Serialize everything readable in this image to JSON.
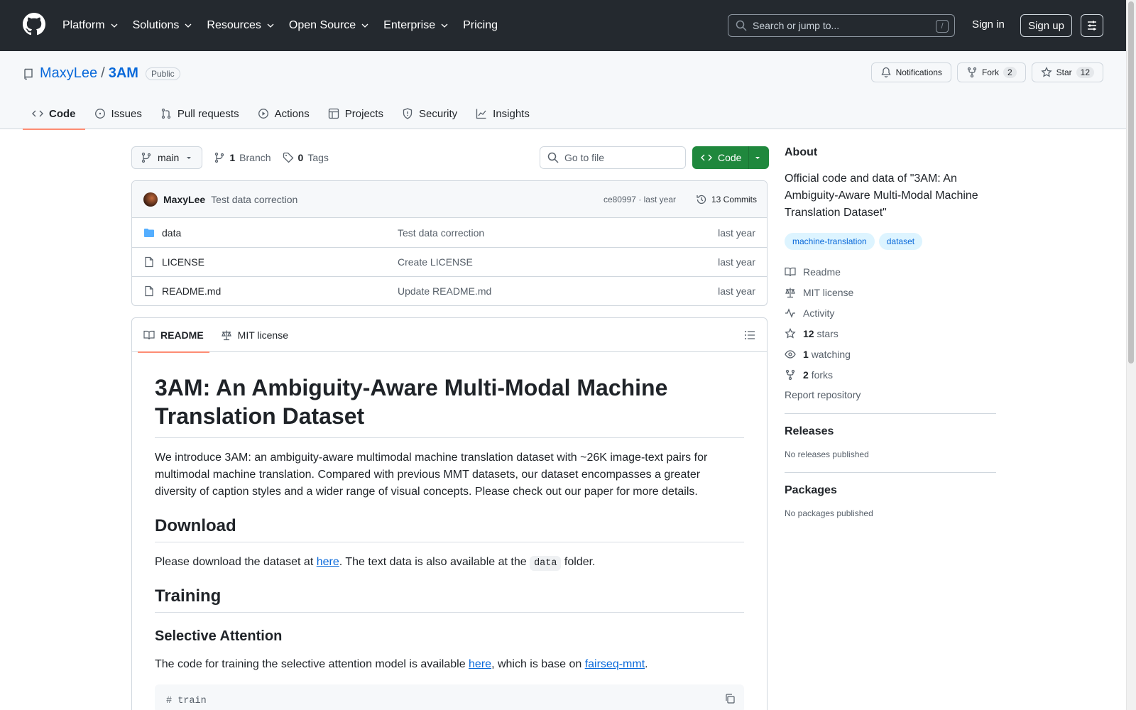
{
  "header": {
    "nav": [
      {
        "label": "Platform",
        "dropdown": true
      },
      {
        "label": "Solutions",
        "dropdown": true
      },
      {
        "label": "Resources",
        "dropdown": true
      },
      {
        "label": "Open Source",
        "dropdown": true
      },
      {
        "label": "Enterprise",
        "dropdown": true
      },
      {
        "label": "Pricing",
        "dropdown": false
      }
    ],
    "search_placeholder": "Search or jump to...",
    "search_shortcut": "/",
    "sign_in": "Sign in",
    "sign_up": "Sign up"
  },
  "repo": {
    "owner": "MaxyLee",
    "separator": "/",
    "name": "3AM",
    "visibility": "Public",
    "notifications_label": "Notifications",
    "fork_label": "Fork",
    "fork_count": "2",
    "star_label": "Star",
    "star_count": "12",
    "tabs": [
      {
        "label": "Code",
        "icon": "code-icon",
        "active": true
      },
      {
        "label": "Issues",
        "icon": "issue-icon",
        "active": false
      },
      {
        "label": "Pull requests",
        "icon": "pull-request-icon",
        "active": false
      },
      {
        "label": "Actions",
        "icon": "play-icon",
        "active": false
      },
      {
        "label": "Projects",
        "icon": "table-icon",
        "active": false
      },
      {
        "label": "Security",
        "icon": "shield-icon",
        "active": false
      },
      {
        "label": "Insights",
        "icon": "graph-icon",
        "active": false
      }
    ]
  },
  "filebar": {
    "branch": "main",
    "branch_count": "1",
    "branch_label": "Branch",
    "tag_count": "0",
    "tag_label": "Tags",
    "goto_placeholder": "Go to file",
    "code_button": "Code"
  },
  "commit": {
    "author": "MaxyLee",
    "message": "Test data correction",
    "meta": "ce80997 · last year",
    "count_label": "13 Commits"
  },
  "files": [
    {
      "name": "data",
      "type": "folder",
      "message": "Test data correction",
      "date": "last year"
    },
    {
      "name": "LICENSE",
      "type": "file",
      "message": "Create LICENSE",
      "date": "last year"
    },
    {
      "name": "README.md",
      "type": "file",
      "message": "Update README.md",
      "date": "last year"
    }
  ],
  "readme": {
    "tabs": [
      {
        "label": "README",
        "active": true
      },
      {
        "label": "MIT license",
        "active": false
      }
    ],
    "title": "3AM: An Ambiguity-Aware Multi-Modal Machine Translation Dataset",
    "intro": "We introduce 3AM: an ambiguity-aware multimodal machine translation dataset with ~26K image-text pairs for multimodal machine translation. Compared with previous MMT datasets, our dataset encompasses a greater diversity of caption styles and a wider range of visual concepts. Please check out our paper for more details.",
    "download_heading": "Download",
    "download_pre": "Please download the dataset at ",
    "download_link": "here",
    "download_mid": ". The text data is also available at the ",
    "download_code": "data",
    "download_post": " folder.",
    "training_heading": "Training",
    "selective_heading": "Selective Attention",
    "selective_pre": "The code for training the selective attention model is available ",
    "selective_link": "here",
    "selective_mid": ", which is base on ",
    "selective_link2": "fairseq-mmt",
    "selective_post": ".",
    "code_snippet": "# train"
  },
  "sidebar": {
    "about_heading": "About",
    "description": "Official code and data of \"3AM: An Ambiguity-Aware Multi-Modal Machine Translation Dataset\"",
    "topics": [
      "machine-translation",
      "dataset"
    ],
    "links": [
      {
        "icon": "book-icon",
        "label": "Readme",
        "count": ""
      },
      {
        "icon": "law-icon",
        "label": "MIT license",
        "count": ""
      },
      {
        "icon": "pulse-icon",
        "label": "Activity",
        "count": ""
      },
      {
        "icon": "star-icon",
        "label": "stars",
        "count": "12"
      },
      {
        "icon": "eye-icon",
        "label": "watching",
        "count": "1"
      },
      {
        "icon": "fork-icon",
        "label": "forks",
        "count": "2"
      }
    ],
    "report": "Report repository",
    "releases_heading": "Releases",
    "releases_text": "No releases published",
    "packages_heading": "Packages",
    "packages_text": "No packages published"
  }
}
